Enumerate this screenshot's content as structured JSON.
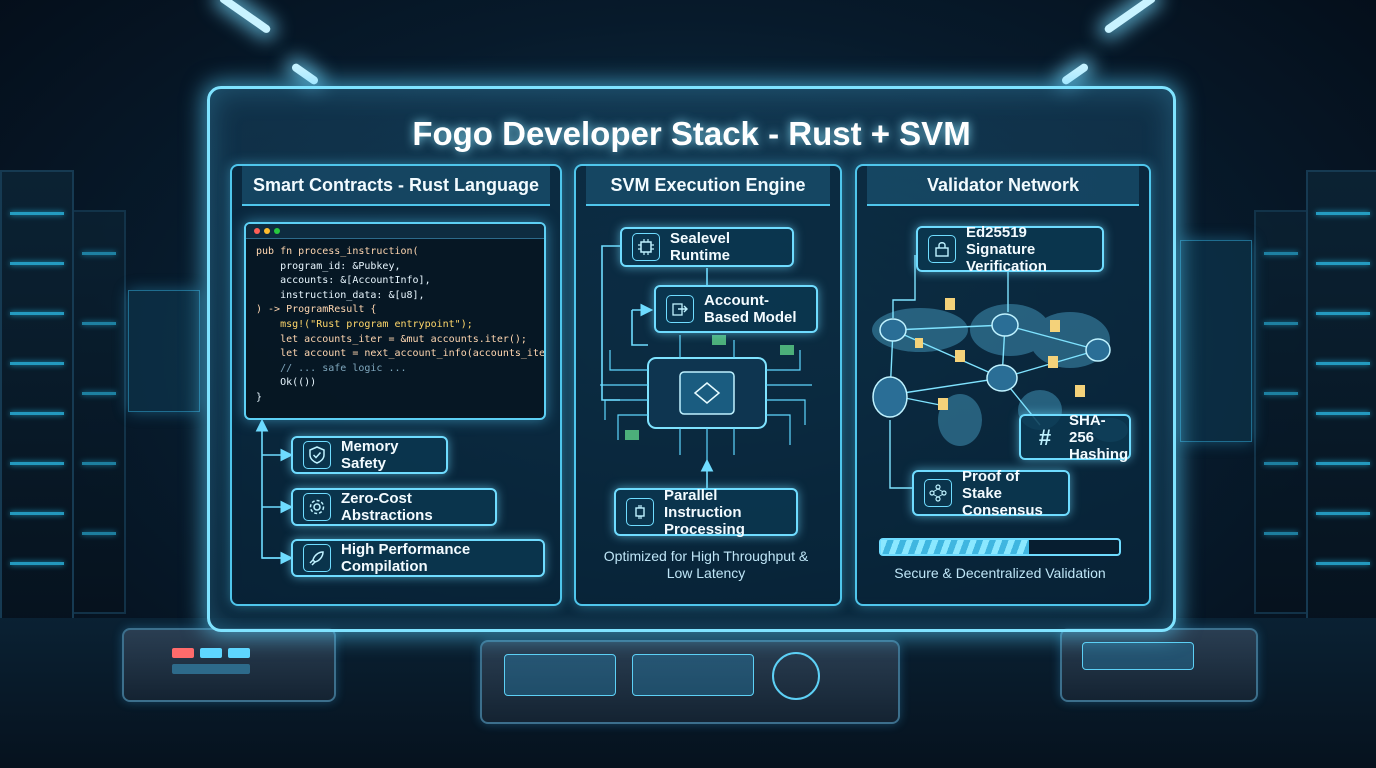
{
  "title": "Fogo Developer Stack - Rust + SVM",
  "columns": {
    "rust": {
      "header": "Smart Contracts - Rust Language",
      "code": [
        "pub fn process_instruction(",
        "    program_id: &Pubkey,",
        "    accounts: &[AccountInfo],",
        "    instruction_data: &[u8],",
        ") -> ProgramResult {",
        "    msg!(\"Rust program entrypoint\");",
        "    let accounts_iter = &mut accounts.iter();",
        "    let account = next_account_info(accounts_iter)?;",
        "    // ... safe logic ...",
        "    Ok(())",
        "}"
      ],
      "features": [
        {
          "label": "Memory Safety",
          "icon": "shield-check-icon"
        },
        {
          "label": "Zero-Cost Abstractions",
          "icon": "gear-icon"
        },
        {
          "label": "High Performance Compilation",
          "icon": "rocket-icon"
        }
      ]
    },
    "svm": {
      "header": "SVM Execution Engine",
      "sealevel": "Sealevel Runtime",
      "account_model": "Account-Based Model",
      "parallel": "Parallel Instruction Processing",
      "caption": "Optimized for High Throughput & Low Latency"
    },
    "validator": {
      "header": "Validator Network",
      "signature": "Ed25519 Signature Verification",
      "hashing": "SHA-256 Hashing",
      "consensus": "Proof of Stake Consensus",
      "caption": "Secure & Decentralized Validation",
      "progress": 0.62
    }
  },
  "colors": {
    "accent": "#6fdcff",
    "glow": "#4fc6ec",
    "keyword": "#ff9a5c",
    "string": "#ffd76b",
    "type": "#8fe08a"
  }
}
